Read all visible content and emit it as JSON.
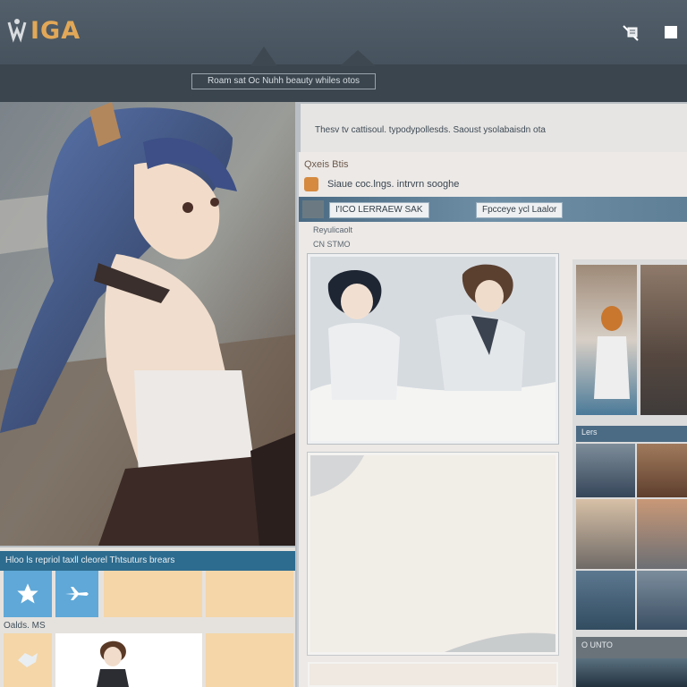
{
  "app": {
    "logo_text": "IGA",
    "subtitle": "Roam sat Oc Nuhh beauty whiles otos"
  },
  "header": {
    "icons": [
      "crop-tool-icon",
      "square-icon"
    ]
  },
  "content": {
    "breadcrumb": "Thesv tv cattisoul. typodypollesds. Saoust ysolabaisdn ota",
    "window_title": "Qxeis Btis",
    "window_subtitle": "Siaue coc.lngs. intrvrn sooghe",
    "buttons": [
      "I'ICO LERRAEW SAK",
      "Fpcceye ycl Laalor"
    ],
    "meta_line_1": "Reyulicaolt",
    "meta_line_2": "CN STMO"
  },
  "left_panel": {
    "bar_title": "Hloo ls repriol taxll cleorel Thtsuturs brears",
    "section_label": "Oalds. MS",
    "tile_icons": [
      "star-icon",
      "plane-icon"
    ]
  },
  "sidebar": {
    "label_1": "Lers",
    "label_2": "O  UNTO"
  },
  "colors": {
    "header": "#4e5b66",
    "accent_orange": "#e2a857",
    "band_blue": "#2d6c8f",
    "tile_peach": "#f4d6a8",
    "tile_sky": "#5fa8d8"
  }
}
